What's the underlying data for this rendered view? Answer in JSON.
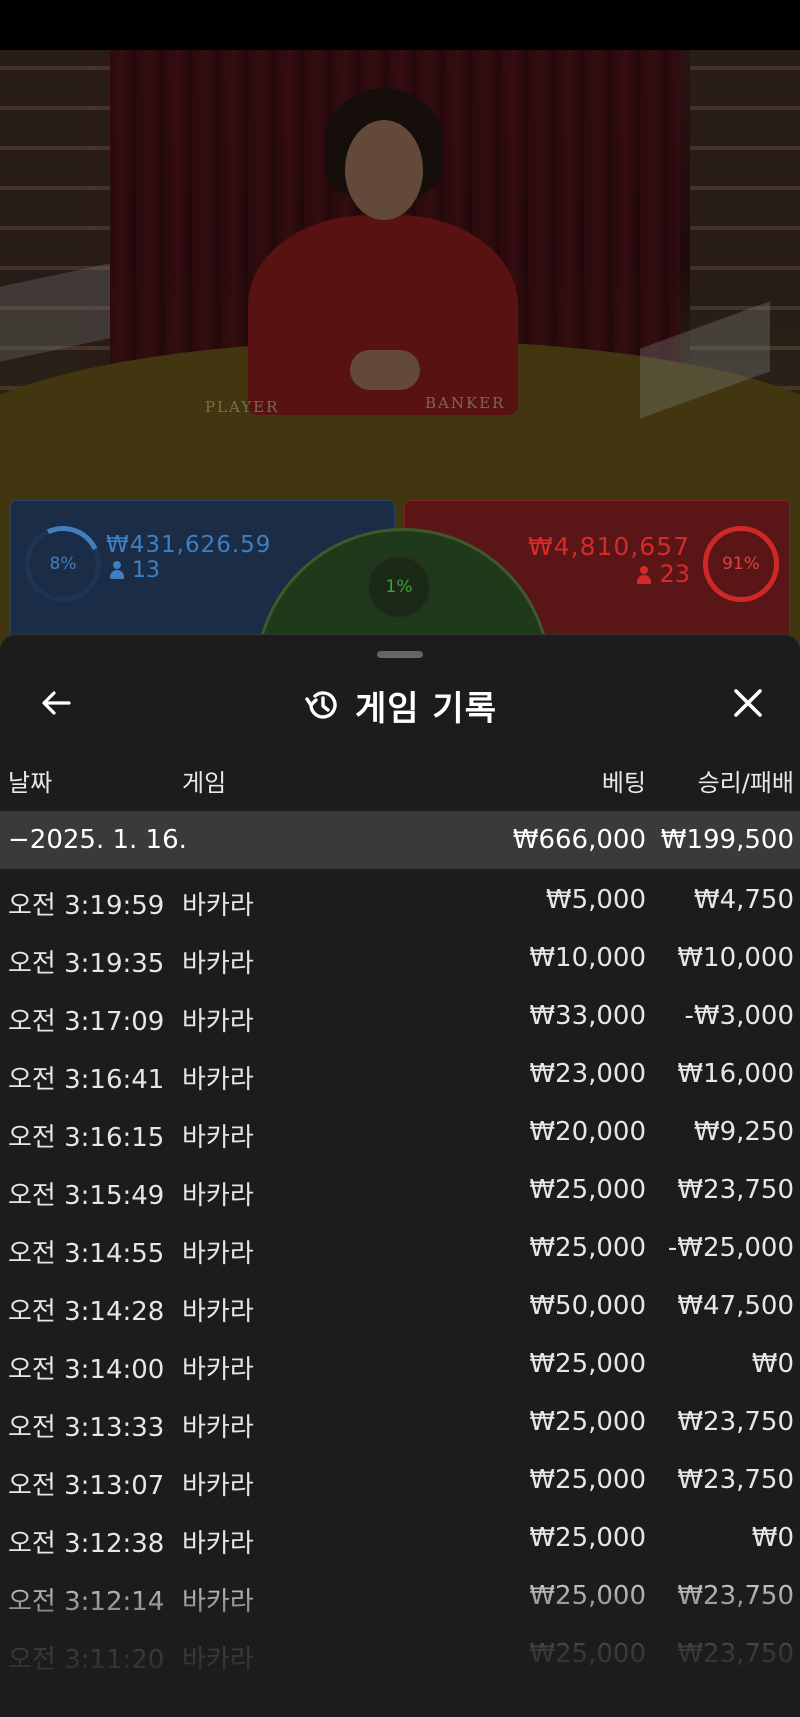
{
  "video": {
    "felt_player_label": "PLAYER",
    "felt_banker_label": "BANKER"
  },
  "bets": {
    "player": {
      "percent_label": "8%",
      "amount": "₩431,626.59",
      "count": "13",
      "color": "#3f7fc0"
    },
    "tie": {
      "percent_label": "1%",
      "color": "#3fa03a"
    },
    "banker": {
      "percent_label": "91%",
      "amount": "₩4,810,657",
      "count": "23",
      "color": "#d52a2a"
    }
  },
  "sheet": {
    "title": "게임 기록",
    "back_icon": "arrow-left-icon",
    "history_icon": "history-icon",
    "close_icon": "close-icon",
    "columns": {
      "date": "날짜",
      "game": "게임",
      "bet": "베팅",
      "win_loss": "승리/패배"
    },
    "summary": {
      "date": "−2025. 1. 16.",
      "bet": "₩666,000",
      "win_loss": "₩199,500"
    },
    "rows": [
      {
        "time": "오전 3:19:59",
        "game": "바카라",
        "bet": "₩5,000",
        "win_loss": "₩4,750"
      },
      {
        "time": "오전 3:19:35",
        "game": "바카라",
        "bet": "₩10,000",
        "win_loss": "₩10,000"
      },
      {
        "time": "오전 3:17:09",
        "game": "바카라",
        "bet": "₩33,000",
        "win_loss": "-₩3,000"
      },
      {
        "time": "오전 3:16:41",
        "game": "바카라",
        "bet": "₩23,000",
        "win_loss": "₩16,000"
      },
      {
        "time": "오전 3:16:15",
        "game": "바카라",
        "bet": "₩20,000",
        "win_loss": "₩9,250"
      },
      {
        "time": "오전 3:15:49",
        "game": "바카라",
        "bet": "₩25,000",
        "win_loss": "₩23,750"
      },
      {
        "time": "오전 3:14:55",
        "game": "바카라",
        "bet": "₩25,000",
        "win_loss": "-₩25,000"
      },
      {
        "time": "오전 3:14:28",
        "game": "바카라",
        "bet": "₩50,000",
        "win_loss": "₩47,500"
      },
      {
        "time": "오전 3:14:00",
        "game": "바카라",
        "bet": "₩25,000",
        "win_loss": "₩0"
      },
      {
        "time": "오전 3:13:33",
        "game": "바카라",
        "bet": "₩25,000",
        "win_loss": "₩23,750"
      },
      {
        "time": "오전 3:13:07",
        "game": "바카라",
        "bet": "₩25,000",
        "win_loss": "₩23,750"
      },
      {
        "time": "오전 3:12:38",
        "game": "바카라",
        "bet": "₩25,000",
        "win_loss": "₩0"
      },
      {
        "time": "오전 3:12:14",
        "game": "바카라",
        "bet": "₩25,000",
        "win_loss": "₩23,750"
      },
      {
        "time": "오전 3:11:20",
        "game": "바카라",
        "bet": "₩25,000",
        "win_loss": "₩23,750"
      }
    ]
  }
}
